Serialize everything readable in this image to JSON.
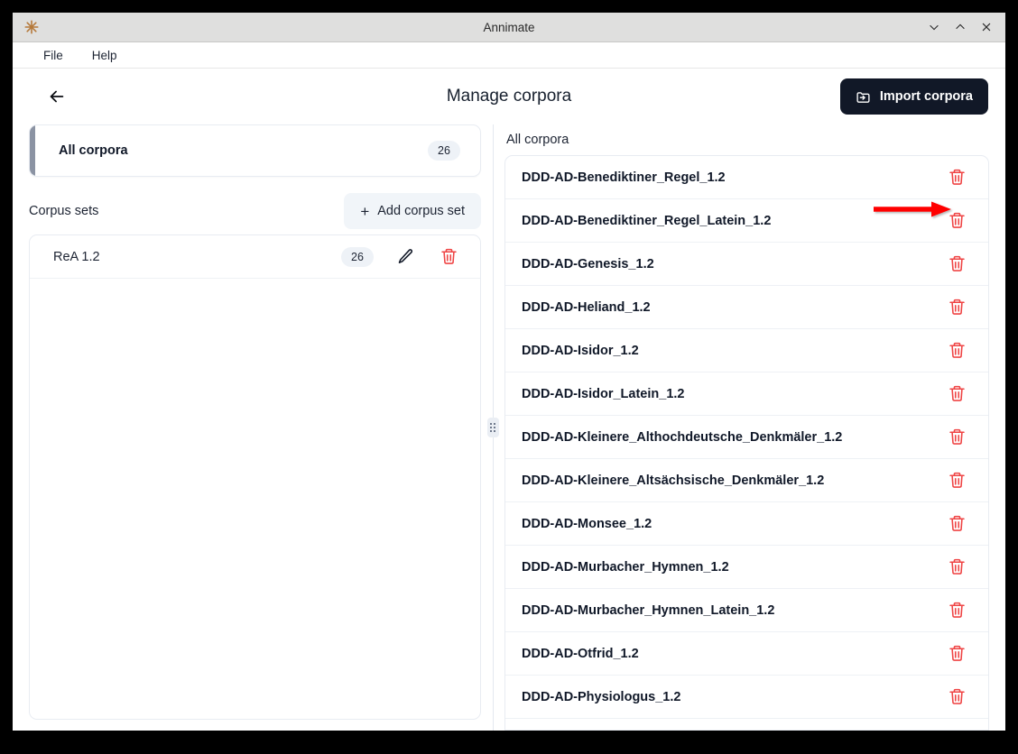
{
  "window": {
    "title": "Annimate",
    "app_icon": "asterisk-star-icon",
    "controls": {
      "minimize": "minimize-icon",
      "maximize": "maximize-icon",
      "close": "close-icon"
    }
  },
  "menu": {
    "items": [
      {
        "label": "File"
      },
      {
        "label": "Help"
      }
    ]
  },
  "header": {
    "back_icon": "arrow-left-icon",
    "title": "Manage corpora",
    "import_button": {
      "label": "Import corpora",
      "icon": "folder-import-icon",
      "background": "#111827",
      "text_color": "#ffffff"
    }
  },
  "left_pane": {
    "all_corpora": {
      "label": "All corpora",
      "count": "26",
      "accent_color": "#8b93a3",
      "selected": true
    },
    "corpus_sets": {
      "title": "Corpus sets",
      "add_button": {
        "label": "Add corpus set",
        "icon": "plus-icon"
      },
      "rows": [
        {
          "name": "ReA 1.2",
          "count": "26",
          "edit_icon": "pencil-icon",
          "delete_icon": "trash-icon"
        }
      ]
    }
  },
  "splitter": {
    "icon": "grip-vertical-icon"
  },
  "right_pane": {
    "title": "All corpora",
    "delete_icon": "trash-icon",
    "rows": [
      {
        "name": "DDD-AD-Benediktiner_Regel_1.2"
      },
      {
        "name": "DDD-AD-Benediktiner_Regel_Latein_1.2"
      },
      {
        "name": "DDD-AD-Genesis_1.2"
      },
      {
        "name": "DDD-AD-Heliand_1.2"
      },
      {
        "name": "DDD-AD-Isidor_1.2"
      },
      {
        "name": "DDD-AD-Isidor_Latein_1.2"
      },
      {
        "name": "DDD-AD-Kleinere_Althochdeutsche_Denkmäler_1.2"
      },
      {
        "name": "DDD-AD-Kleinere_Altsächsische_Denkmäler_1.2"
      },
      {
        "name": "DDD-AD-Monsee_1.2"
      },
      {
        "name": "DDD-AD-Murbacher_Hymnen_1.2"
      },
      {
        "name": "DDD-AD-Murbacher_Hymnen_Latein_1.2"
      },
      {
        "name": "DDD-AD-Otfrid_1.2"
      },
      {
        "name": "DDD-AD-Physiologus_1.2"
      }
    ]
  },
  "annotation": {
    "arrow_color": "#ff0000",
    "points_to": "delete-corpus-button-row-1"
  },
  "colors": {
    "danger": "#ef4444",
    "badge_bg": "#eef2f7",
    "border": "#e8ecf2",
    "title_bar": "#dfdfde"
  }
}
